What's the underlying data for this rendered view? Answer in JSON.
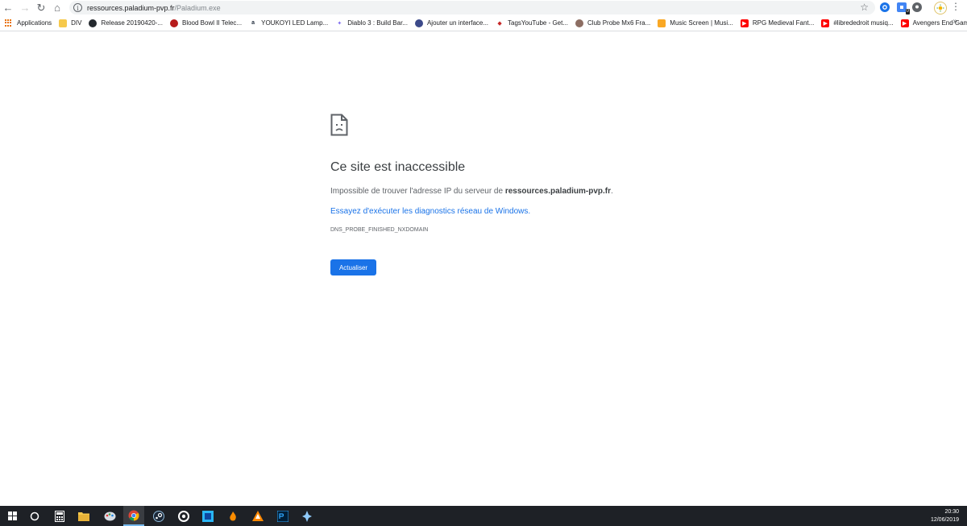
{
  "browser": {
    "url_host": "ressources.paladium-pvp.fr",
    "url_path": "/Paladium.exe",
    "colors": {
      "accent": "#1a73e8",
      "taskbar": "#1e2126"
    }
  },
  "toolbar": {
    "back_icon": "←",
    "forward_icon": "→",
    "reload_icon": "↻",
    "home_icon": "⌂",
    "info_icon": "i",
    "star_icon": "☆",
    "menu_icon": "⋮",
    "ext_badge": "0"
  },
  "bookmarks": {
    "items": [
      {
        "label": "Applications",
        "icon": "apps-grid-icon"
      },
      {
        "label": "DIV",
        "icon": "folder-icon",
        "color": "#f6c94c"
      },
      {
        "label": "Release 20190420-...",
        "icon": "github-icon",
        "color": "#24292e"
      },
      {
        "label": "Blood Bowl II Telec...",
        "icon": "bloodbowl-icon",
        "color": "#b71c1c"
      },
      {
        "label": "YOUKOYI LED Lamp...",
        "icon": "amazon-icon",
        "color": "#232f3e"
      },
      {
        "label": "Diablo 3 : Build Bar...",
        "icon": "diablo-icon",
        "color": "#7b68ee"
      },
      {
        "label": "Ajouter un interface...",
        "icon": "site-icon",
        "color": "#3c4a8a"
      },
      {
        "label": "TagsYouTube - Get...",
        "icon": "tags-icon",
        "color": "#c62828"
      },
      {
        "label": "Club Probe Mx6 Fra...",
        "icon": "club-icon",
        "color": "#8d6e63"
      },
      {
        "label": "Music Screen | Musi...",
        "icon": "music-icon",
        "color": "#f9a825"
      },
      {
        "label": "RPG Medieval Fant...",
        "icon": "youtube-icon",
        "color": "#ff0000"
      },
      {
        "label": "#librededroit musiq...",
        "icon": "youtube-icon",
        "color": "#ff0000"
      },
      {
        "label": "Avengers End Gam...",
        "icon": "youtube-icon",
        "color": "#ff0000"
      }
    ],
    "more_icon": "»"
  },
  "error": {
    "title": "Ce site est inaccessible",
    "desc_prefix": "Impossible de trouver l'adresse IP du serveur de ",
    "desc_host": "ressources.paladium-pvp.fr",
    "desc_suffix": ".",
    "link": "Essayez d'exécuter les diagnostics réseau de Windows.",
    "code": "DNS_PROBE_FINISHED_NXDOMAIN",
    "reload_label": "Actualiser"
  },
  "taskbar": {
    "items": [
      {
        "name": "windows-start-icon"
      },
      {
        "name": "cortana-search-icon"
      },
      {
        "name": "calculator-icon"
      },
      {
        "name": "file-explorer-icon"
      },
      {
        "name": "paint-icon"
      },
      {
        "name": "chrome-icon",
        "active": true
      },
      {
        "name": "steam-icon"
      },
      {
        "name": "app-circle-icon"
      },
      {
        "name": "app-square-icon"
      },
      {
        "name": "app-flame-icon"
      },
      {
        "name": "vlc-icon"
      },
      {
        "name": "photoshop-icon"
      },
      {
        "name": "app-star-icon"
      }
    ],
    "time": "20:30",
    "date": "12/06/2019"
  }
}
